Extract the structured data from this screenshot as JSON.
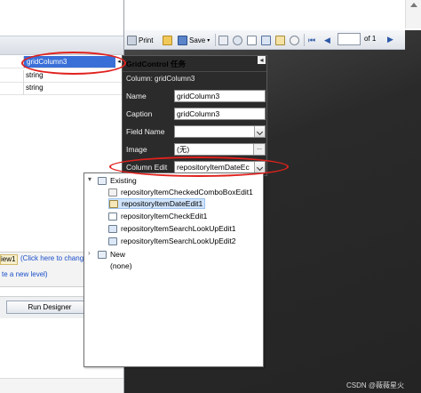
{
  "grid": {
    "selected_cell": "gridColumn3",
    "rows": [
      "string",
      "string"
    ]
  },
  "left_panel": {
    "level_chip": "iew1",
    "change_link": "(Click here to chang",
    "new_level_link": "te a new level)",
    "run_designer": "Run Designer"
  },
  "toolbar": {
    "print": "Print",
    "save": "Save",
    "page_of": "of 1"
  },
  "tasks_panel": {
    "title": "GridControl 任务",
    "subtitle": "Column: gridColumn3",
    "name_label": "Name",
    "name_value": "gridColumn3",
    "caption_label": "Caption",
    "caption_value": "gridColumn3",
    "field_name_label": "Field Name",
    "field_name_value": "",
    "image_label": "Image",
    "image_value": "(无)",
    "column_edit_label": "Column Edit",
    "column_edit_value": "repositoryItemDateEc"
  },
  "dropdown": {
    "existing": "Existing",
    "items": [
      "repositoryItemCheckedComboBoxEdit1",
      "repositoryItemDateEdit1",
      "repositoryItemCheckEdit1",
      "repositoryItemSearchLookUpEdit1",
      "repositoryItemSearchLookUpEdit2"
    ],
    "new": "New",
    "none": "(none)"
  },
  "watermark": "CSDN @薇薇星火",
  "colors": {
    "annotation": "#e0211d",
    "selection": "#3a6fd8",
    "panel_bg": "#2b2b2b"
  }
}
